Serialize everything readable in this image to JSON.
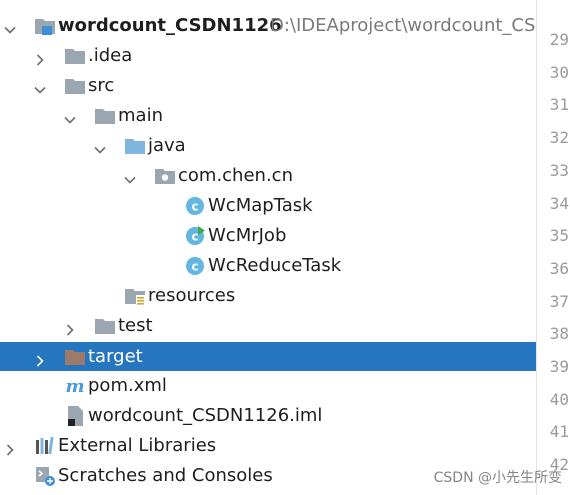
{
  "tree": [
    {
      "label": "wordcount_CSDN1126",
      "path": "D:\\IDEAproject\\wordcount_CSD",
      "icon": "project-module-icon",
      "arrow": "down"
    },
    {
      "label": ".idea",
      "icon": "folder-icon",
      "arrow": "right"
    },
    {
      "label": "src",
      "icon": "folder-icon",
      "arrow": "down"
    },
    {
      "label": "main",
      "icon": "folder-icon",
      "arrow": "down"
    },
    {
      "label": "java",
      "icon": "source-folder-icon",
      "arrow": "down"
    },
    {
      "label": "com.chen.cn",
      "icon": "package-icon",
      "arrow": "down"
    },
    {
      "label": "WcMapTask",
      "icon": "class-icon"
    },
    {
      "label": "WcMrJob",
      "icon": "runnable-class-icon"
    },
    {
      "label": "WcReduceTask",
      "icon": "class-icon"
    },
    {
      "label": "resources",
      "icon": "resources-folder-icon"
    },
    {
      "label": "test",
      "icon": "folder-icon",
      "arrow": "right"
    },
    {
      "label": "target",
      "icon": "excluded-folder-icon",
      "arrow": "right",
      "selected": true
    },
    {
      "label": "pom.xml",
      "icon": "maven-icon"
    },
    {
      "label": "wordcount_CSDN1126.iml",
      "icon": "iml-file-icon"
    },
    {
      "label": "External Libraries",
      "icon": "libraries-icon",
      "arrow": "right"
    },
    {
      "label": "Scratches and Consoles",
      "icon": "scratches-icon"
    }
  ],
  "line_numbers": [
    "29",
    "30",
    "31",
    "32",
    "33",
    "34",
    "35",
    "36",
    "37",
    "38",
    "39",
    "40",
    "41",
    "42"
  ],
  "watermark": "CSDN @小先生所变",
  "colors": {
    "selection": "#2675bf",
    "folder": "#9aa7b0",
    "source_folder": "#7fb6e0",
    "excluded_folder": "#9c7b6a",
    "class_circle": "#62b6e2",
    "run_marker": "#3fa84a",
    "maven": "#4d9ad6"
  }
}
